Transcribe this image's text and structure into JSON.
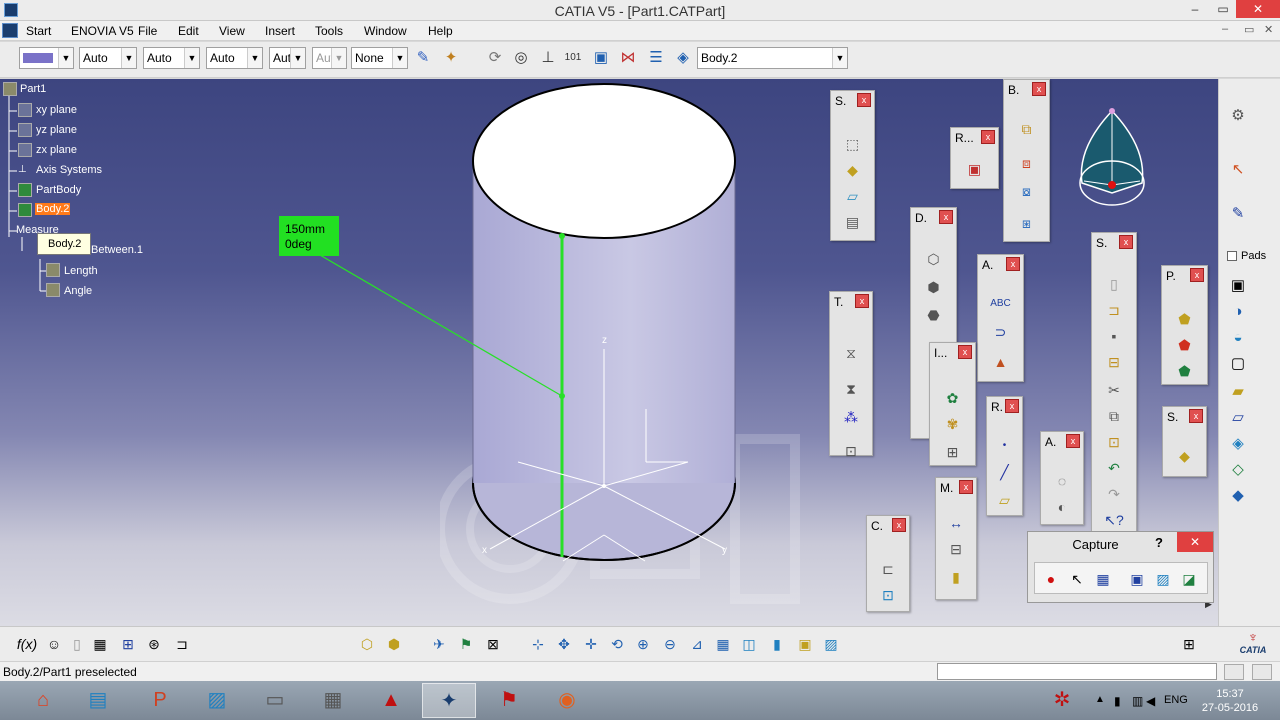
{
  "window": {
    "title": "CATIA V5 - [Part1.CATPart]",
    "minimize": "0",
    "restore": "▭",
    "close": "✕"
  },
  "menu": {
    "items": [
      "Start",
      "ENOVIA V5",
      "File",
      "Edit",
      "View",
      "Insert",
      "Tools",
      "Window",
      "Help"
    ]
  },
  "toolbar": {
    "line_width": "Auto",
    "line_type": "Auto",
    "layer_combo": "Auto",
    "aut_combo": "Aut",
    "aut_combo_disabled": "Aut",
    "none_combo": "None",
    "body_combo": "Body.2"
  },
  "tree": {
    "root": "Part1",
    "xy": "xy plane",
    "yz": "yz plane",
    "zx": "zx plane",
    "axis": "Axis Systems",
    "partbody": "PartBody",
    "body2": "Body.2",
    "measure": "Measure",
    "between": "Between.1",
    "length": "Length",
    "angle": "Angle",
    "tooltip": "Body.2"
  },
  "measurement": {
    "line1": "150mm",
    "line2": "0deg"
  },
  "axes": {
    "x": "x",
    "y": "y",
    "z": "z"
  },
  "panels": {
    "s1": "S.",
    "r1": "R...",
    "b1": "B.",
    "d1": "D.",
    "a1": "A.",
    "t1": "T.",
    "i1": "I...",
    "r2": "R.",
    "s2": "S.",
    "p1": "P.",
    "a2": "A.",
    "m1": "M.",
    "c1": "C.",
    "s3": "S.",
    "close": "x"
  },
  "right_toolbar": {
    "pads_label": "Pads"
  },
  "capture": {
    "title": "Capture",
    "help": "?",
    "close": "✕"
  },
  "status": {
    "text": "Body.2/Part1 preselected"
  },
  "taskbar": {
    "lang": "ENG",
    "time": "15:37",
    "date": "27-05-2016"
  },
  "brand": {
    "catia": "CATIA"
  },
  "colors": {
    "measure_green": "#22e022",
    "highlight_orange": "#ff7a1a",
    "close_red": "#e04040"
  }
}
